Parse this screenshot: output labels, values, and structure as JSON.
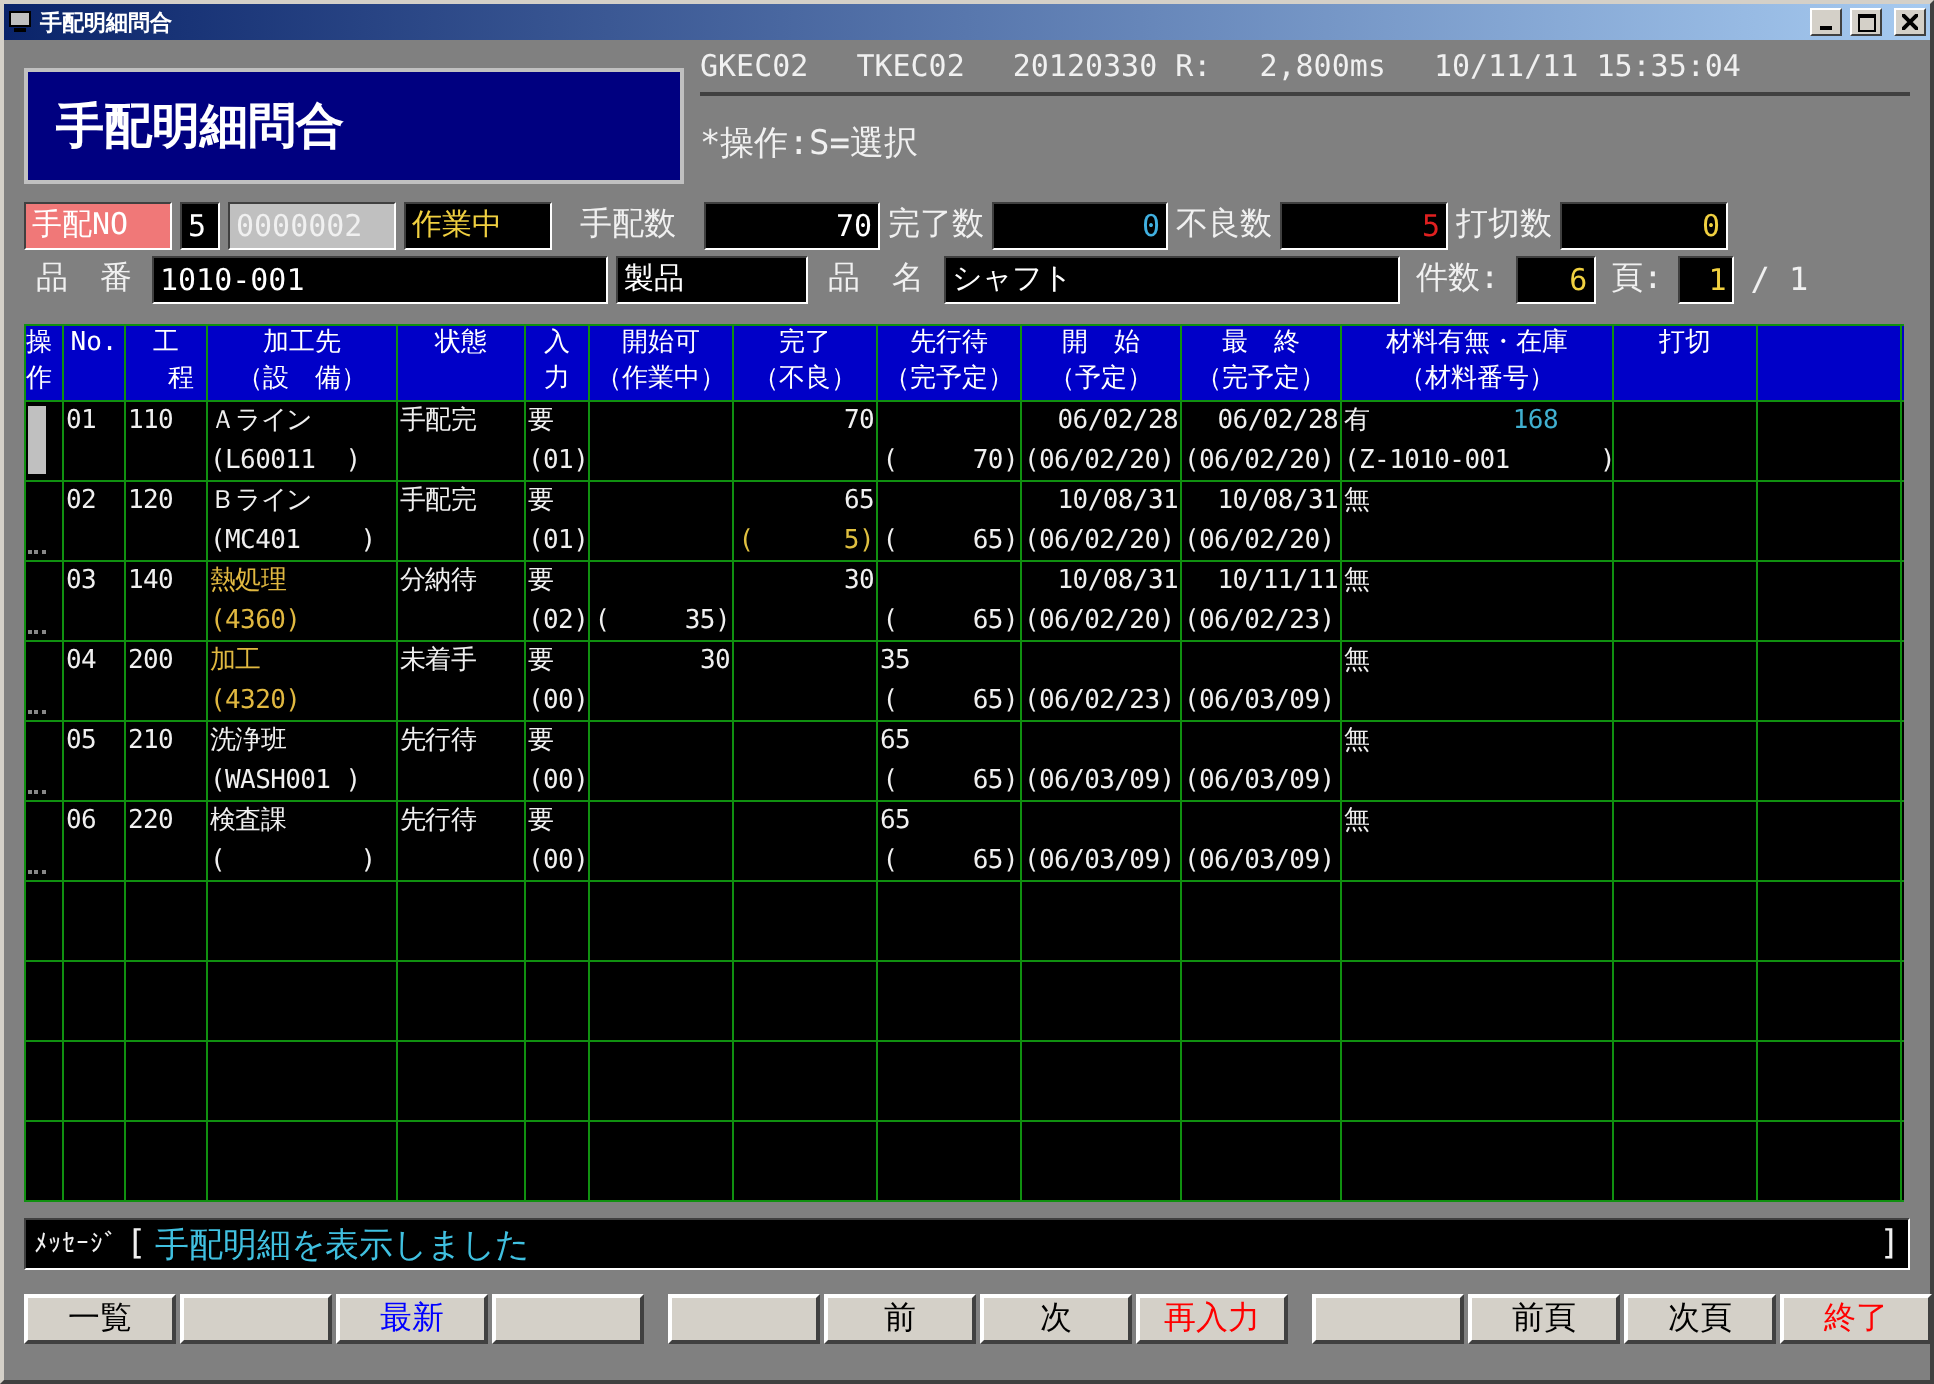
{
  "window": {
    "title": "手配明細問合"
  },
  "header": {
    "screen_title": "手配明細問合",
    "program_id": "GKEC02",
    "terminal_id": "TKEC02",
    "version": "20120330 R:",
    "response_time": "2,800ms",
    "timestamp": "10/11/11 15:35:04",
    "hint": "*操作:S=選択"
  },
  "order": {
    "label": "手配NO",
    "branch": "5",
    "number": "0000002",
    "state": "作業中",
    "qty_label": "手配数",
    "qty": "70",
    "done_label": "完了数",
    "done": "0",
    "defect_label": "不良数",
    "defect": "5",
    "cut_label": "打切数",
    "cut": "0"
  },
  "item": {
    "part_label": "品　番",
    "part_no": "1010-001",
    "category": "製品",
    "name_label": "品　名",
    "name": "シャフト",
    "count_label": "件数:",
    "count": "6",
    "page_label": "頁:",
    "page": "1",
    "page_total": "/ 1"
  },
  "table": {
    "columns": [
      {
        "line1": "操",
        "line2": "作"
      },
      {
        "line1": "No."
      },
      {
        "line1": "工",
        "line2": "程"
      },
      {
        "line1": "加工先",
        "line2": "（設　備）"
      },
      {
        "line1": "状態"
      },
      {
        "line1": "入",
        "line2": "力"
      },
      {
        "line1": "開始可",
        "line2": "（作業中）"
      },
      {
        "line1": "完了",
        "line2": "（不良）"
      },
      {
        "line1": "先行待",
        "line2": "（完予定）"
      },
      {
        "line1": "開　始",
        "line2": "（予定）"
      },
      {
        "line1": "最　終",
        "line2": "（完予定）"
      },
      {
        "line1": "材料有無・在庫",
        "line2": "（材料番号）"
      },
      {
        "line1": "打切"
      },
      {}
    ],
    "rows": [
      {
        "focused": true,
        "no": "01",
        "process": "110",
        "destination": "Ａライン",
        "equipment": "(L60011  )",
        "highlighted": false,
        "status": "手配完",
        "input": "要",
        "input_code": "(01)",
        "done": "70",
        "scheduled_done": "(     70)",
        "start": "06/02/28",
        "start_planned": "(06/02/20)",
        "finish": "06/02/28",
        "finish_planned": "(06/02/20)",
        "material": "有",
        "stock": "168",
        "material_no": "(Z-1010-001      )"
      },
      {
        "focused": false,
        "no": "02",
        "process": "120",
        "destination": "Ｂライン",
        "equipment": "(MC401    )",
        "highlighted": false,
        "status": "手配完",
        "input": "要",
        "input_code": "(01)",
        "done": "65",
        "defects": "(      5)",
        "scheduled_done": "(     65)",
        "start": "10/08/31",
        "start_planned": "(06/02/20)",
        "finish": "10/08/31",
        "finish_planned": "(06/02/20)",
        "material": "無"
      },
      {
        "focused": false,
        "no": "03",
        "process": "140",
        "destination": "熱処理",
        "equipment": "(4360)",
        "highlighted": true,
        "status": "分納待",
        "input": "要",
        "input_code": "(02)",
        "in_progress": "(     35)",
        "done": "30",
        "scheduled_done": "(     65)",
        "start": "10/08/31",
        "start_planned": "(06/02/20)",
        "finish": "10/11/11",
        "finish_planned": "(06/02/23)",
        "material": "無"
      },
      {
        "focused": false,
        "no": "04",
        "process": "200",
        "destination": "加工",
        "equipment": "(4320)",
        "highlighted": true,
        "status": "未着手",
        "input": "要",
        "input_code": "(00)",
        "startable": "30",
        "prior_wait": "35",
        "scheduled_done": "(     65)",
        "start_planned": "(06/02/23)",
        "finish_planned": "(06/03/09)",
        "material": "無"
      },
      {
        "focused": false,
        "no": "05",
        "process": "210",
        "destination": "洗浄班",
        "equipment": "(WASH001 )",
        "highlighted": false,
        "status": "先行待",
        "input": "要",
        "input_code": "(00)",
        "prior_wait": "65",
        "scheduled_done": "(     65)",
        "start_planned": "(06/03/09)",
        "finish_planned": "(06/03/09)",
        "material": "無"
      },
      {
        "focused": false,
        "no": "06",
        "process": "220",
        "destination": "検査課",
        "equipment": "(         )",
        "highlighted": false,
        "status": "先行待",
        "input": "要",
        "input_code": "(00)",
        "prior_wait": "65",
        "scheduled_done": "(     65)",
        "start_planned": "(06/03/09)",
        "finish_planned": "(06/03/09)",
        "material": "無"
      }
    ]
  },
  "message": {
    "label": "ﾒｯｾｰｼﾞ",
    "open": "[",
    "text": "手配明細を表示しました",
    "close": "]"
  },
  "function_keys": [
    [
      {
        "kind": "label",
        "label": "一覧",
        "color": "#000000"
      },
      {
        "kind": "blank"
      },
      {
        "kind": "label",
        "label": "最新",
        "color": "#0000ff"
      },
      {
        "kind": "blank"
      }
    ],
    [
      {
        "kind": "blank"
      },
      {
        "kind": "label",
        "label": "前",
        "color": "#000000"
      },
      {
        "kind": "label",
        "label": "次",
        "color": "#000000"
      },
      {
        "kind": "label",
        "label": "再入力",
        "color": "#ff0000"
      }
    ],
    [
      {
        "kind": "blank"
      },
      {
        "kind": "label",
        "label": "前頁",
        "color": "#000000"
      },
      {
        "kind": "label",
        "label": "次頁",
        "color": "#000000"
      },
      {
        "kind": "label",
        "label": "終了",
        "color": "#ff0000"
      }
    ]
  ]
}
